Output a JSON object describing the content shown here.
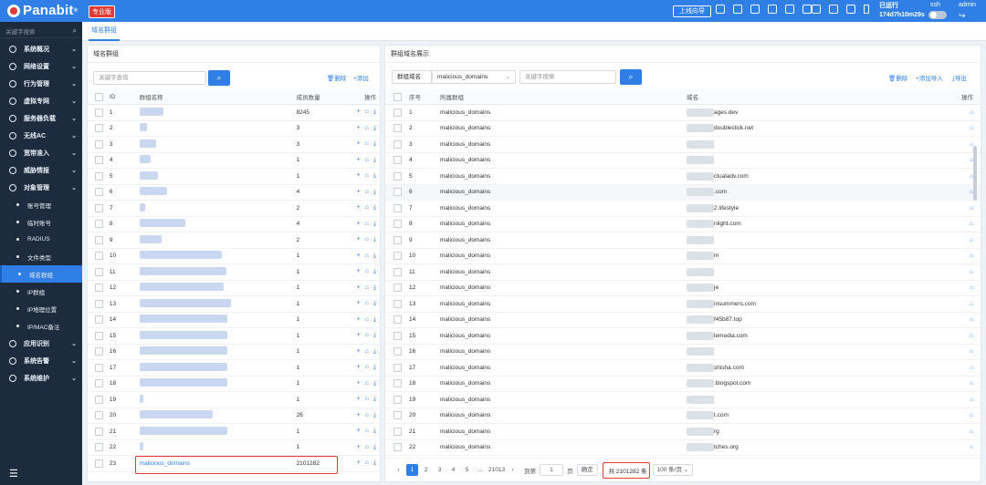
{
  "topbar": {
    "logo": "Panabit",
    "edition": "专业版",
    "guide": "上线向导",
    "runtime_label": "已运行",
    "runtime_value": "174d7h10m29s",
    "ssh_label": "ssh",
    "user": "admin"
  },
  "sidebar": {
    "search_placeholder": "关键字搜索",
    "items": [
      {
        "label": "系统概况"
      },
      {
        "label": "网络设置"
      },
      {
        "label": "行为管理"
      },
      {
        "label": "虚拟专网"
      },
      {
        "label": "服务器负载"
      },
      {
        "label": "无线AC"
      },
      {
        "label": "宽带准入"
      },
      {
        "label": "威胁情报"
      },
      {
        "label": "对象管理"
      }
    ],
    "subitems": [
      {
        "label": "账号管理"
      },
      {
        "label": "临时账号"
      },
      {
        "label": "RADIUS"
      },
      {
        "label": "文件类型"
      },
      {
        "label": "域名群组"
      },
      {
        "label": "IP群组"
      },
      {
        "label": "IP地理位置"
      },
      {
        "label": "IP/MAC备注"
      }
    ],
    "bottom_items": [
      {
        "label": "应用识别"
      },
      {
        "label": "系统告警"
      },
      {
        "label": "系统维护"
      }
    ]
  },
  "tab": {
    "label": "域名群组"
  },
  "left": {
    "title": "域名群组",
    "search_placeholder": "关键字查询",
    "delete": "删除",
    "add": "添加",
    "headers": {
      "id": "ID",
      "name": "群组名称",
      "count": "成员数量",
      "ops": "操作"
    },
    "rows": [
      {
        "id": "1",
        "count": "8245"
      },
      {
        "id": "2",
        "count": "3"
      },
      {
        "id": "3",
        "count": "3"
      },
      {
        "id": "4",
        "count": "1"
      },
      {
        "id": "5",
        "count": "1"
      },
      {
        "id": "6",
        "count": "4"
      },
      {
        "id": "7",
        "count": "2"
      },
      {
        "id": "8",
        "count": "4"
      },
      {
        "id": "9",
        "count": "2"
      },
      {
        "id": "10",
        "count": "1"
      },
      {
        "id": "11",
        "count": "1"
      },
      {
        "id": "12",
        "count": "1"
      },
      {
        "id": "13",
        "count": "1"
      },
      {
        "id": "14",
        "count": "1"
      },
      {
        "id": "15",
        "count": "1"
      },
      {
        "id": "16",
        "count": "1"
      },
      {
        "id": "17",
        "count": "1"
      },
      {
        "id": "18",
        "count": "1"
      },
      {
        "id": "19",
        "count": "1"
      },
      {
        "id": "20",
        "count": "26"
      },
      {
        "id": "21",
        "count": "1"
      },
      {
        "id": "22",
        "count": "1"
      },
      {
        "id": "23",
        "name": "malicious_domains",
        "count": "2101282"
      }
    ]
  },
  "right": {
    "title": "群组域名展示",
    "select_label": "群组域名",
    "select_value": "malicious_domains",
    "search_placeholder": "关键字搜索",
    "delete": "删除",
    "add_import": "添加导入",
    "export": "导出",
    "headers": {
      "seq": "序号",
      "group": "所属群组",
      "domain": "域名",
      "ops": "操作"
    },
    "rows": [
      {
        "seq": "1",
        "group": "malicious_domains",
        "domain": "ages.dev"
      },
      {
        "seq": "2",
        "group": "malicious_domains",
        "domain": "doubleclick.net"
      },
      {
        "seq": "3",
        "group": "malicious_domains",
        "domain": ""
      },
      {
        "seq": "4",
        "group": "malicious_domains",
        "domain": ""
      },
      {
        "seq": "5",
        "group": "malicious_domains",
        "domain": "ctualadv.com"
      },
      {
        "seq": "6",
        "group": "malicious_domains",
        "domain": ".com"
      },
      {
        "seq": "7",
        "group": "malicious_domains",
        "domain": "2.lifestyle"
      },
      {
        "seq": "8",
        "group": "malicious_domains",
        "domain": "nlight.com"
      },
      {
        "seq": "9",
        "group": "malicious_domains",
        "domain": ""
      },
      {
        "seq": "10",
        "group": "malicious_domains",
        "domain": "m"
      },
      {
        "seq": "11",
        "group": "malicious_domains",
        "domain": ""
      },
      {
        "seq": "12",
        "group": "malicious_domains",
        "domain": "je"
      },
      {
        "seq": "13",
        "group": "malicious_domains",
        "domain": "insummers.com"
      },
      {
        "seq": "14",
        "group": "malicious_domains",
        "domain": "f45b87.top"
      },
      {
        "seq": "15",
        "group": "malicious_domains",
        "domain": "lemedia.com"
      },
      {
        "seq": "16",
        "group": "malicious_domains",
        "domain": ""
      },
      {
        "seq": "17",
        "group": "malicious_domains",
        "domain": "shisha.com"
      },
      {
        "seq": "18",
        "group": "malicious_domains",
        "domain": ".blogspot.com"
      },
      {
        "seq": "19",
        "group": "malicious_domains",
        "domain": ""
      },
      {
        "seq": "20",
        "group": "malicious_domains",
        "domain": "t.com"
      },
      {
        "seq": "21",
        "group": "malicious_domains",
        "domain": "rg"
      },
      {
        "seq": "22",
        "group": "malicious_domains",
        "domain": "tches.org"
      }
    ],
    "pager": {
      "pages": [
        "1",
        "2",
        "3",
        "4",
        "5",
        "...",
        "21013"
      ],
      "goto": "到第",
      "page_input": "1",
      "page_unit": "页",
      "confirm": "确定",
      "total": "共 2101282 条",
      "per_page": "100 条/页"
    }
  }
}
